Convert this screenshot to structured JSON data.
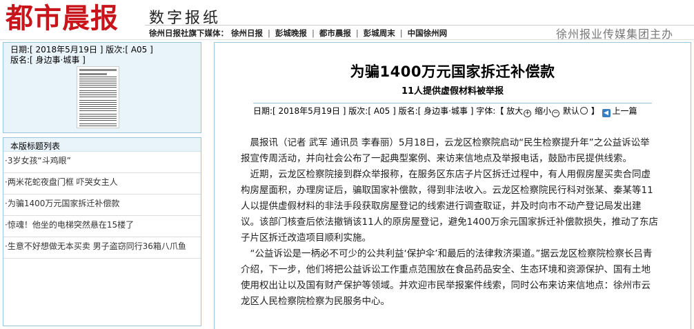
{
  "header": {
    "logo": "都市晨报",
    "digital": "数字报纸",
    "media_prefix": "徐州日报社旗下媒体：",
    "media_links": [
      "徐州日报",
      "彭城晚报",
      "都市晨报",
      "彭城周末",
      "中国徐州网"
    ],
    "separator": "|",
    "group": "徐州报业传媒集团主办"
  },
  "sidebar": {
    "date_line": "日期:[ 2018年5月19日 ] 版次:[ A05 ]",
    "section_line": "版名:[ 身边事·城事 ]",
    "list_title": "本版标题列表",
    "items": [
      "·3岁女孩“斗鸡眼”",
      "·两米花蛇夜盘门框 吓哭女主人",
      "·为骗1400万元国家拆迁补偿款",
      "·惊魂！他坐的电梯突然悬在15楼了",
      "·生意不好想做无本买卖 男子盗窃同行36箱八爪鱼"
    ]
  },
  "article": {
    "title": "为骗1400万元国家拆迁补偿款",
    "subtitle": "11人提供虚假材料被举报",
    "meta_info": "日期:[ 2018年5月19日 ] 版次:[ A05 ] 版名:[ 身边事·城事 ] 字体:【",
    "zoom_in": "放大",
    "zoom_out": "缩小",
    "default": "默认",
    "meta_close": "】",
    "back": "上一篇",
    "paragraphs": [
      "　晨报讯（记者 武军 通讯员 李春丽）5月18日，云龙区检察院启动“民生检察提升年”之公益诉讼举报宣传周活动，并向社会公布了一起典型案例、来访来信地点及举报电话，鼓励市民提供线索。",
      "　近期，云龙区检察院接到群众举报称，在服务区东店子片区拆迁过程中，有人用假房屋买卖合同虚构房屋面积，办理房证后，骗取国家补偿款，得到非法收入。云龙区检察院民行科对张某、秦某等11人以提供虚假材料的非法手段获取房屋登记的线索进行调查取证，并及时向市不动产登记局发出建议。该部门核查后依法撤销该11人的原房屋登记，避免1400万余元国家拆迁补偿款损失，推动了东店子片区拆迁改造项目顺利实施。",
      "　“公益诉讼是一柄必不可少的公共利益‘保护伞’和最后的法律救济渠道。”据云龙区检察院检察长吕青介绍，下一步，他们将把公益诉讼工作重点范围放在食品药品安全、生态环境和资源保护、国有土地使用权出让以及国有财产保护等领域。并欢迎市民举报案件线索，同时公布来访来信地点：徐州市云龙区人民检察院检察为民服务中心。"
    ]
  },
  "colors": {
    "logo_red": "#c8141b",
    "panel_border": "#9cc4dd",
    "panel_fill": "#e9f3fa"
  }
}
